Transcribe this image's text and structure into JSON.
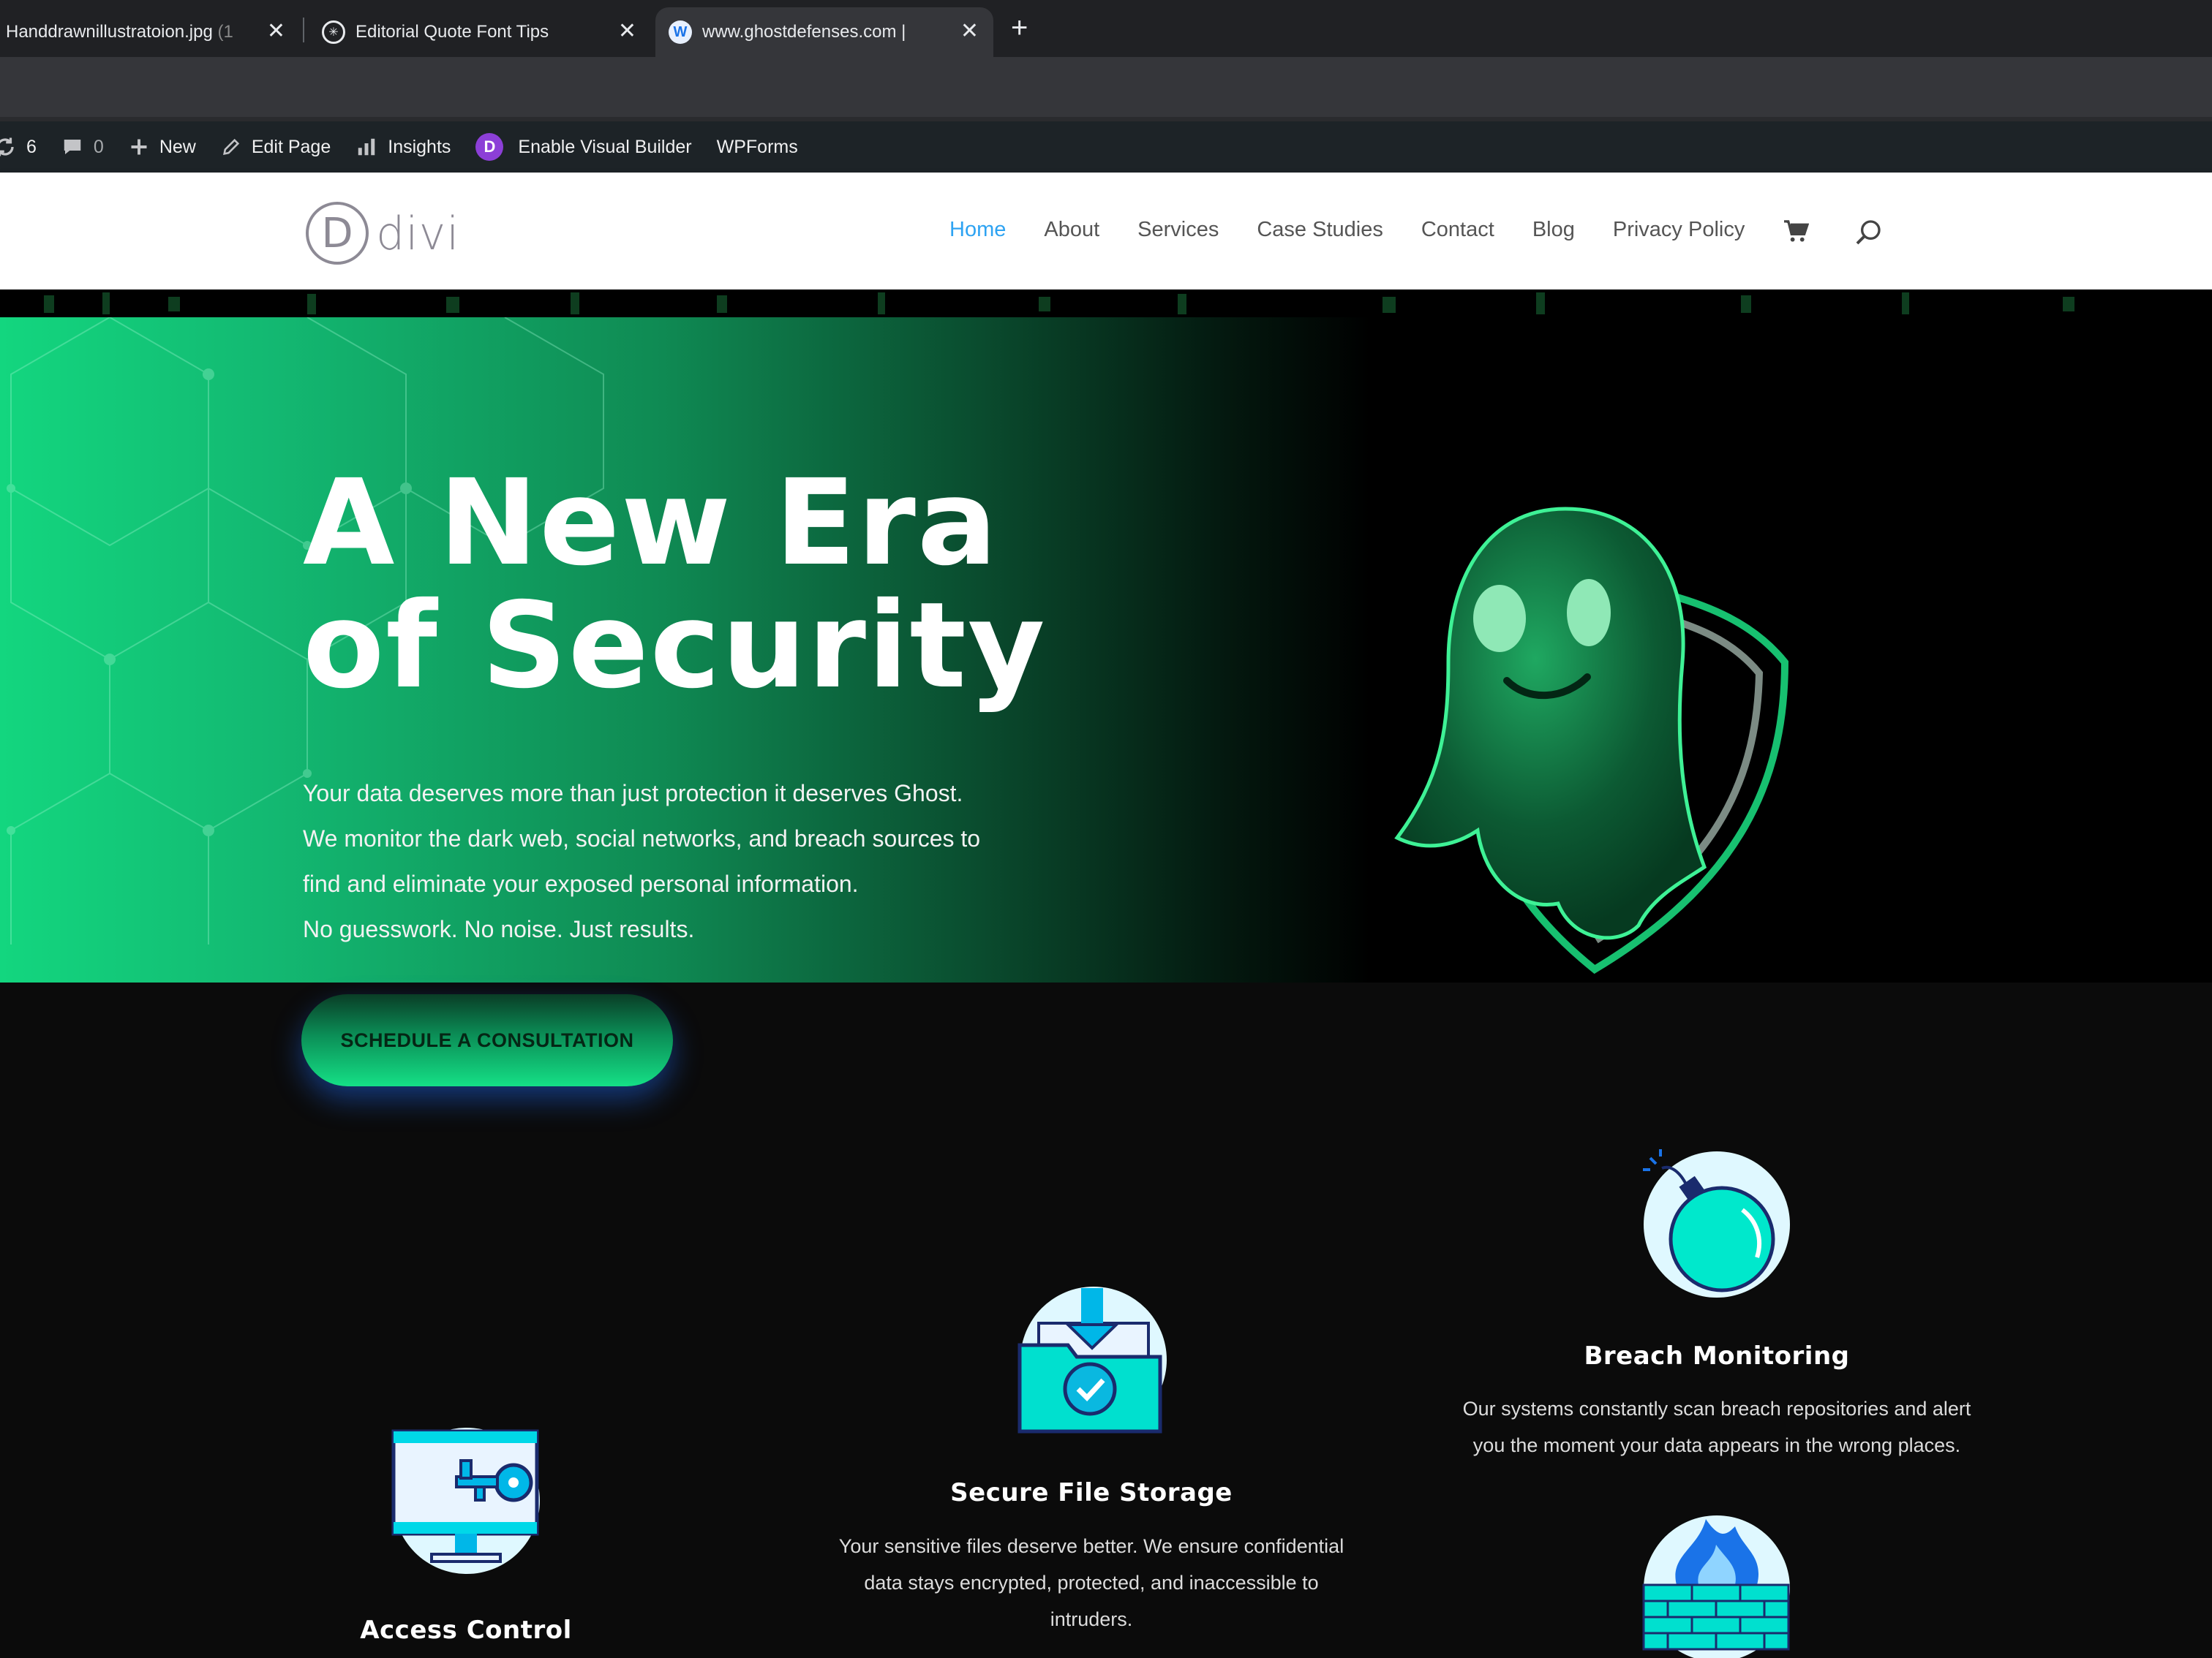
{
  "browser": {
    "tabs": [
      {
        "title": "Handdrawnillustratoion.jpg",
        "faded": "(1"
      },
      {
        "title": "Editorial Quote Font Tips"
      },
      {
        "title": "www.ghostdefenses.com |"
      }
    ],
    "new_tab_glyph": "+",
    "close_glyph": "✕"
  },
  "adminbar": {
    "updates_count": "6",
    "comments_count": "0",
    "new_label": "New",
    "edit_page_label": "Edit Page",
    "insights_label": "Insights",
    "divi_badge": "D",
    "visual_builder_label": "Enable Visual Builder",
    "wpforms_label": "WPForms"
  },
  "site": {
    "logo_letter": "D",
    "logo_text": "divi",
    "nav": [
      "Home",
      "About",
      "Services",
      "Case Studies",
      "Contact",
      "Blog",
      "Privacy Policy"
    ],
    "active_nav": "Home"
  },
  "hero": {
    "title_line1": "A New Era",
    "title_line2": "of Security",
    "text_line1": "Your data deserves more than just protection it deserves Ghost.",
    "text_line2": "We monitor the dark web, social networks, and breach sources to",
    "text_line3": "find and eliminate your exposed personal information.",
    "text_line4": "No guesswork. No noise. Just results.",
    "cta_label": "SCHEDULE A CONSULTATION"
  },
  "services": [
    {
      "title": "Breach Monitoring",
      "desc_line1": "Our systems constantly scan breach repositories and alert",
      "desc_line2": "you the moment your data appears in the wrong places."
    },
    {
      "title": "Secure File Storage",
      "desc_line1": "Your sensitive files deserve better. We ensure confidential",
      "desc_line2": "data stays encrypted, protected, and inaccessible to",
      "desc_line3": "intruders."
    },
    {
      "title": "Access Control"
    }
  ],
  "colors": {
    "accent_blue": "#2ea3f2",
    "hero_green": "#13d67f",
    "icon_cyan": "#00e5d1",
    "admin_bg": "#1d2327"
  },
  "icons": [
    "refresh-icon",
    "comment-icon",
    "plus-icon",
    "pencil-icon",
    "bar-chart-icon",
    "cart-icon",
    "search-icon",
    "bomb-icon",
    "folder-check-icon",
    "monitor-key-icon",
    "firewall-icon"
  ]
}
